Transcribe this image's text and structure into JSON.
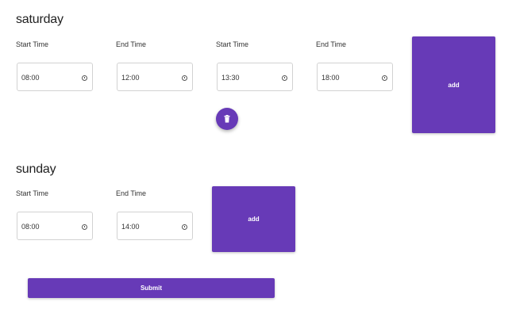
{
  "theme": {
    "accent": "#673ab7"
  },
  "saturday": {
    "title": "saturday",
    "slots": [
      {
        "start_label": "Start Time",
        "start_value": "08:00",
        "end_label": "End Time",
        "end_value": "12:00"
      },
      {
        "start_label": "Start Time",
        "start_value": "13:30",
        "end_label": "End Time",
        "end_value": "18:00"
      }
    ],
    "add_label": "add",
    "delete_icon": "trash-icon"
  },
  "sunday": {
    "title": "sunday",
    "slots": [
      {
        "start_label": "Start Time",
        "start_value": "08:00",
        "end_label": "End Time",
        "end_value": "14:00"
      }
    ],
    "add_label": "add"
  },
  "submit_label": "Submit",
  "icons": {
    "time_field": "clock-icon"
  }
}
